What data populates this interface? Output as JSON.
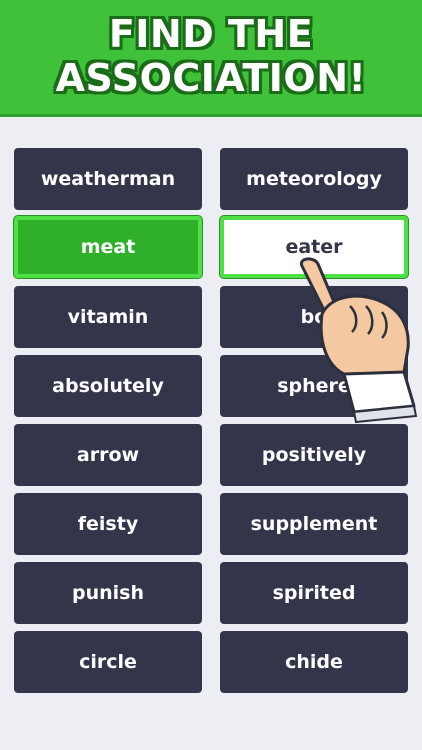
{
  "banner": {
    "line1": "FIND THE",
    "line2": "ASSOCIATION!",
    "color": "#3fc13a"
  },
  "tiles": {
    "left": [
      "weatherman",
      "meat",
      "vitamin",
      "absolutely",
      "arrow",
      "feisty",
      "punish",
      "circle"
    ],
    "right": [
      "meteorology",
      "eater",
      "bo",
      "sphere",
      "positively",
      "supplement",
      "spirited",
      "chide"
    ]
  },
  "colors": {
    "tile": "#33364a",
    "selected_tile": "#2faf2a",
    "highlight_border": "#4fe045",
    "background": "#eceef3"
  },
  "icons": {
    "pointer": "pointing-hand-icon"
  }
}
